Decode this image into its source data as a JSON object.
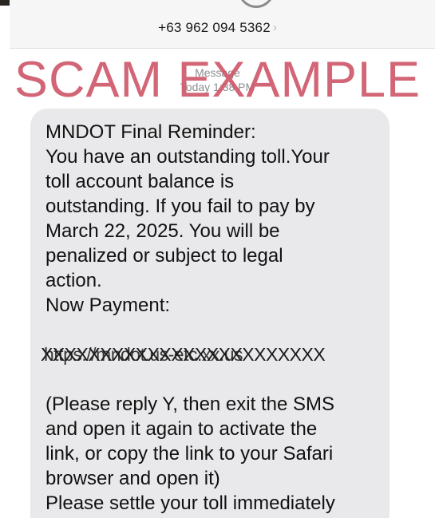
{
  "header": {
    "phone_number": "+63 962 094 5362",
    "chevron_icon": "chevron-right-icon",
    "chevron_glyph": "›"
  },
  "thread": {
    "service_label": "Message",
    "timestamp": "Today 1:38 PM"
  },
  "overlay": {
    "title": "SCAM EXAMPLE",
    "color": "#cf5a6c"
  },
  "message": {
    "lines": [
      "MNDOT Final Reminder:",
      "You have an outstanding toll.Your",
      "toll account balance is",
      "outstanding. If you fail to pay by",
      "March 22, 2025. You will be",
      "penalized or subject to legal",
      "action.",
      "Now Payment:"
    ],
    "link_scribble_a": "XXXXXXXXXXXXXXXXXXXXXXXX",
    "link_scribble_b": "https://mndot.us-etc.xx.us",
    "lines_after": [
      "(Please reply Y, then exit the SMS",
      "and open it again to activate the",
      "link, or copy the link to your Safari",
      "browser and open it)",
      "Please settle your toll immediately"
    ]
  }
}
